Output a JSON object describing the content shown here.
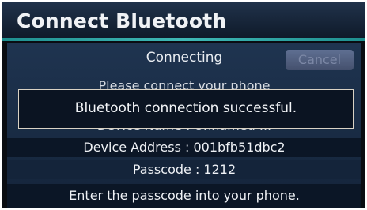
{
  "header": {
    "title": "Connect Bluetooth"
  },
  "status": {
    "connecting": "Connecting",
    "cancel_label": "Cancel"
  },
  "background_lines": {
    "prompt": "Please connect your phone",
    "device_name": "Device Name : Unnamed ..."
  },
  "details": {
    "device_address": "Device Address : 001bfb51dbc2",
    "passcode": "Passcode : 1212",
    "instruction": "Enter the passcode into your phone."
  },
  "toast": {
    "message": "Bluetooth connection successful."
  }
}
